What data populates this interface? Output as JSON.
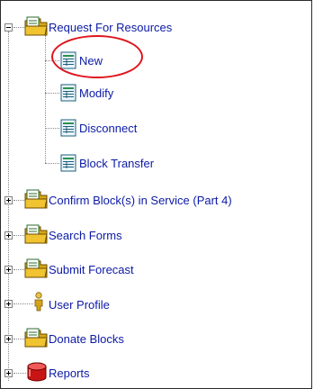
{
  "tree": {
    "items": [
      {
        "label": "Request For Resources",
        "icon": "folder-form-icon",
        "expanded": true
      },
      {
        "label": "New",
        "icon": "document-form-icon"
      },
      {
        "label": "Modify",
        "icon": "document-form-icon"
      },
      {
        "label": "Disconnect",
        "icon": "document-form-icon"
      },
      {
        "label": "Block Transfer",
        "icon": "document-form-icon"
      },
      {
        "label": "Confirm Block(s) in Service (Part 4)",
        "icon": "folder-form-icon",
        "expanded": false
      },
      {
        "label": "Search Forms",
        "icon": "folder-form-icon",
        "expanded": false
      },
      {
        "label": "Submit Forecast",
        "icon": "folder-form-icon",
        "expanded": false
      },
      {
        "label": "User Profile",
        "icon": "person-icon",
        "expanded": false
      },
      {
        "label": "Donate Blocks",
        "icon": "folder-form-icon",
        "expanded": false
      },
      {
        "label": "Reports",
        "icon": "database-cylinder-icon",
        "expanded": false
      }
    ]
  },
  "annotation": {
    "highlight_color": "#e0141c",
    "highlighted_item": "New"
  }
}
